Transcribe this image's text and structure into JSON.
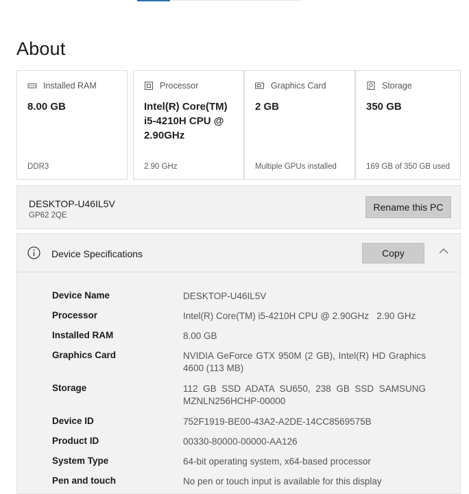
{
  "page": {
    "title": "About"
  },
  "cards": [
    {
      "icon": "ram-icon",
      "label": "Installed RAM",
      "value": "8.00 GB",
      "footer": "DDR3"
    },
    {
      "icon": "processor-icon",
      "label": "Processor",
      "value": "Intel(R) Core(TM) i5-4210H CPU @ 2.90GHz",
      "footer": "2.90 GHz"
    },
    {
      "icon": "graphics-card-icon",
      "label": "Graphics Card",
      "value": "2 GB",
      "footer": "Multiple GPUs installed"
    },
    {
      "icon": "storage-icon",
      "label": "Storage",
      "value": "350 GB",
      "footer": "169 GB of 350 GB used"
    }
  ],
  "device": {
    "name": "DESKTOP-U46IL5V",
    "model": "GP62 2QE",
    "rename_label": "Rename this PC"
  },
  "specs": {
    "title": "Device Specifications",
    "copy_label": "Copy",
    "rows": [
      {
        "key": "Device Name",
        "value": "DESKTOP-U46IL5V"
      },
      {
        "key": "Processor",
        "value": "Intel(R) Core(TM) i5-4210H CPU @ 2.90GHz   2.90 GHz"
      },
      {
        "key": "Installed RAM",
        "value": "8.00 GB"
      },
      {
        "key": "Graphics Card",
        "value": "NVIDIA GeForce GTX 950M (2 GB), Intel(R) HD Graphics 4600 (113 MB)"
      },
      {
        "key": "Storage",
        "value": "112 GB SSD ADATA SU650, 238 GB SSD SAMSUNG MZNLN256HCHP-00000"
      },
      {
        "key": "Device ID",
        "value": "752F1919-BE00-43A2-A2DE-14CC8569575B"
      },
      {
        "key": "Product ID",
        "value": "00330-80000-00000-AA126"
      },
      {
        "key": "System Type",
        "value": "64-bit operating system, x64-based processor"
      },
      {
        "key": "Pen and touch",
        "value": "No pen or touch input is available for this display"
      }
    ]
  }
}
